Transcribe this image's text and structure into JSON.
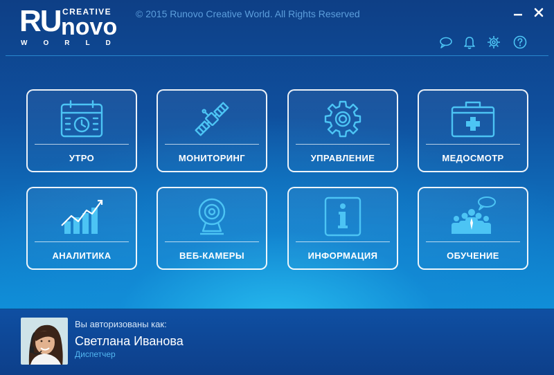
{
  "header": {
    "logo": {
      "ru": "RU",
      "novo": "novo",
      "creative": "CREATIVE",
      "world": "WORLD"
    },
    "copyright": "© 2015 Runovo Creative World. All Rights Reserved",
    "icons": [
      "chat-icon",
      "bell-icon",
      "gear-icon",
      "help-icon"
    ],
    "window_controls": [
      "minimize",
      "close"
    ]
  },
  "tiles": [
    {
      "label": "УТРО",
      "icon": "calendar-clock-icon"
    },
    {
      "label": "МОНИТОРИНГ",
      "icon": "satellite-icon"
    },
    {
      "label": "УПРАВЛЕНИЕ",
      "icon": "gear-icon"
    },
    {
      "label": "МЕДОСМОТР",
      "icon": "medical-kit-icon"
    },
    {
      "label": "АНАЛИТИКА",
      "icon": "bar-chart-icon"
    },
    {
      "label": "ВЕБ-КАМЕРЫ",
      "icon": "webcam-icon"
    },
    {
      "label": "ИНФОРМАЦИЯ",
      "icon": "info-icon"
    },
    {
      "label": "ОБУЧЕНИЕ",
      "icon": "team-training-icon"
    }
  ],
  "user": {
    "auth_label": "Вы авторизованы как:",
    "name": "Светлана Иванова",
    "role": "Диспетчер"
  },
  "colors": {
    "accent": "#4cc4f4",
    "role_text": "#53b6f0",
    "copyright_text": "#5c9edc",
    "background_top": "#0e3f86",
    "background_glow": "#1fa6e6"
  }
}
